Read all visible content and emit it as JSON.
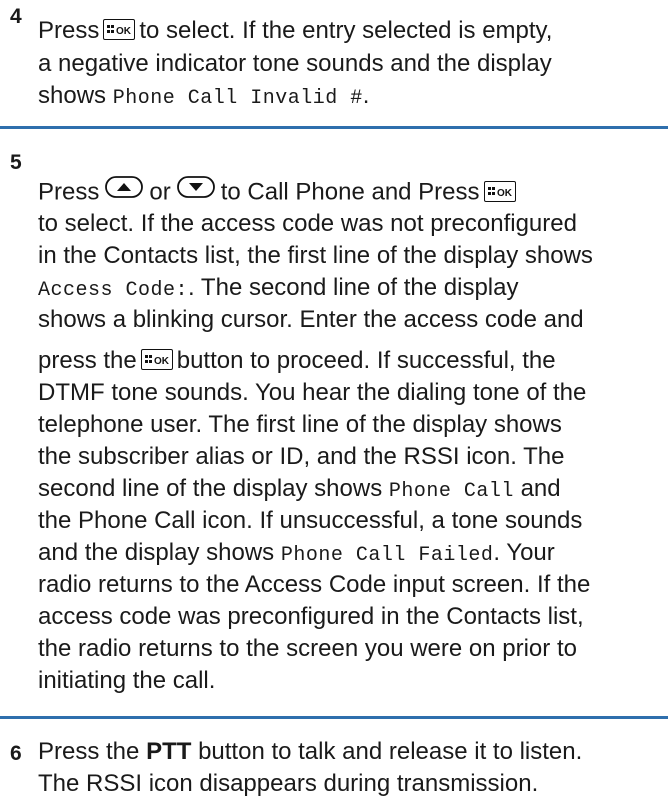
{
  "step4": {
    "number": "4",
    "l1a": "Press",
    "l1b": "to select. If the entry selected is empty,",
    "l2": "a negative indicator tone sounds and the display",
    "l3a": "shows",
    "l3mono": "Phone Call Invalid #",
    "l3b": "."
  },
  "step5": {
    "number": "5",
    "l1a": "Press",
    "l1b": "or",
    "l1c": "to Call Phone and Press",
    "l2": "to select. If the access code was not preconfigured",
    "l3": "in the Contacts list, the first line of the display shows",
    "l4mono": "Access Code:",
    "l4b": ". The second line of the display",
    "l5": "shows a blinking cursor. Enter the access code and",
    "l6a": "press the",
    "l6b": "button to proceed. If successful, the",
    "l7": "DTMF tone sounds. You hear the dialing tone of the",
    "l8": "telephone user. The first line of the display shows",
    "l9": "the subscriber alias or ID, and the RSSI icon. The",
    "l10a": "second line of the display shows",
    "l10mono": "Phone Call",
    "l10b": "and",
    "l11": "the Phone Call icon. If unsuccessful, a tone sounds",
    "l12a": "and the display shows",
    "l12mono": "Phone Call Failed",
    "l12b": ". Your",
    "l13": "radio returns to the Access Code input screen. If the",
    "l14": "access code was preconfigured in the Contacts list,",
    "l15": "the radio returns to the screen you were on prior to",
    "l16": "initiating the call."
  },
  "step6": {
    "number": "6",
    "l1a": "Press the",
    "l1bold": "PTT",
    "l1b": "button to talk and release it to listen.",
    "l2": "The RSSI icon disappears during transmission."
  },
  "icons": {
    "ok_key": "menu-ok-key-icon",
    "up_key": "up-arrow-key-icon",
    "down_key": "down-arrow-key-icon"
  },
  "colors": {
    "rule": "#2f6fad",
    "text": "#1a1a1a"
  }
}
